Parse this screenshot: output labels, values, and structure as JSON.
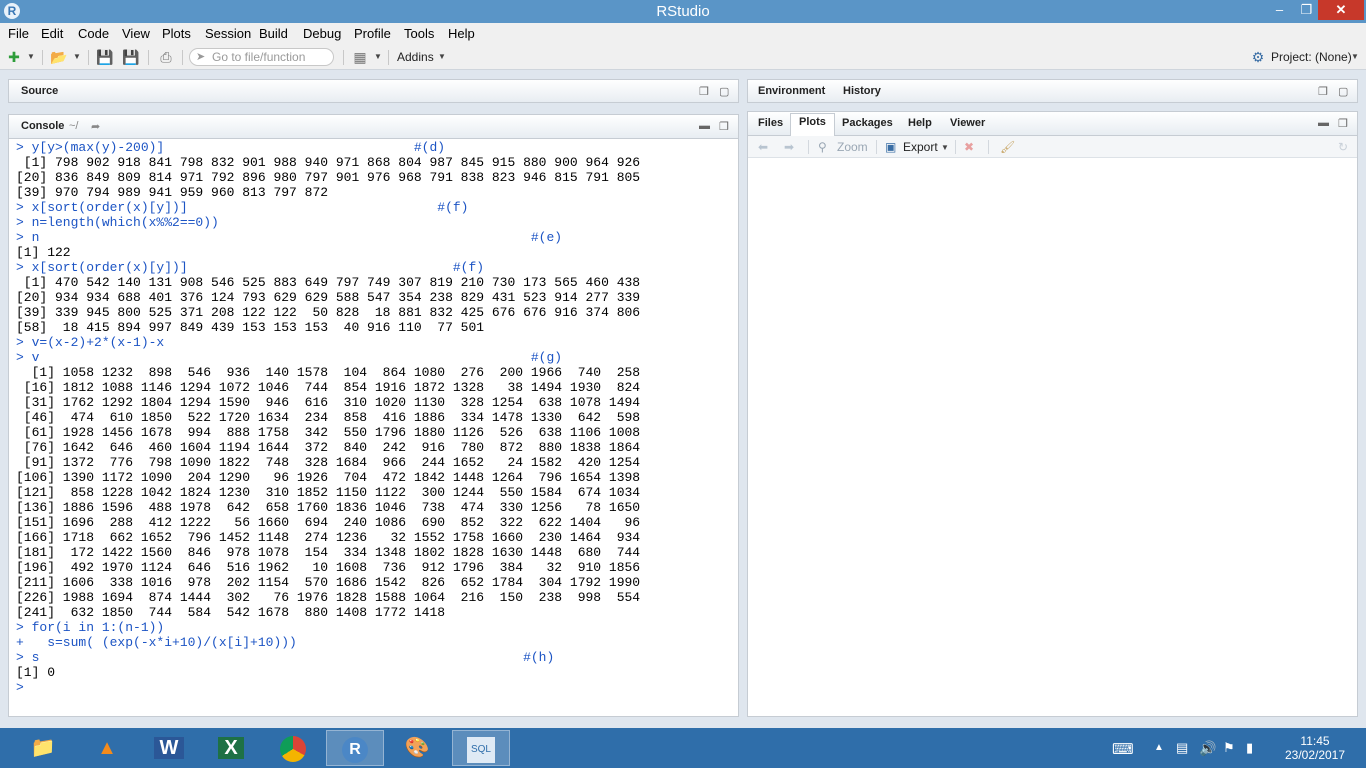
{
  "window": {
    "title": "RStudio"
  },
  "menu": [
    "File",
    "Edit",
    "Code",
    "View",
    "Plots",
    "Session",
    "Build",
    "Debug",
    "Profile",
    "Tools",
    "Help"
  ],
  "toolbar": {
    "goto_placeholder": "Go to file/function",
    "addins_label": "Addins",
    "project_label": "Project: (None)"
  },
  "source_pane": {
    "tab_label": "Source"
  },
  "console": {
    "tab_label": "Console",
    "path": "~/",
    "lines": [
      {
        "t": "cmd",
        "s": "> y[y>(max(y)-200)]                                #(d)"
      },
      {
        "t": "out",
        "s": " [1] 798 902 918 841 798 832 901 988 940 971 868 804 987 845 915 880 900 964 926"
      },
      {
        "t": "out",
        "s": "[20] 836 849 809 814 971 792 896 980 797 901 976 968 791 838 823 946 815 791 805"
      },
      {
        "t": "out",
        "s": "[39] 970 794 989 941 959 960 813 797 872"
      },
      {
        "t": "cmd",
        "s": "> x[sort(order(x)[y])]                                #(f)"
      },
      {
        "t": "cmd",
        "s": "> n=length(which(x%%2==0))"
      },
      {
        "t": "cmd",
        "s": "> n                                                               #(e)"
      },
      {
        "t": "out",
        "s": "[1] 122"
      },
      {
        "t": "cmd",
        "s": "> x[sort(order(x)[y])]                                  #(f)"
      },
      {
        "t": "out",
        "s": " [1] 470 542 140 131 908 546 525 883 649 797 749 307 819 210 730 173 565 460 438"
      },
      {
        "t": "out",
        "s": "[20] 934 934 688 401 376 124 793 629 629 588 547 354 238 829 431 523 914 277 339"
      },
      {
        "t": "out",
        "s": "[39] 339 945 800 525 371 208 122 122  50 828  18 881 832 425 676 676 916 374 806"
      },
      {
        "t": "out",
        "s": "[58]  18 415 894 997 849 439 153 153 153  40 916 110  77 501"
      },
      {
        "t": "cmd",
        "s": "> v=(x-2)+2*(x-1)-x"
      },
      {
        "t": "cmd",
        "s": "> v                                                               #(g)"
      },
      {
        "t": "out",
        "s": "  [1] 1058 1232  898  546  936  140 1578  104  864 1080  276  200 1966  740  258"
      },
      {
        "t": "out",
        "s": " [16] 1812 1088 1146 1294 1072 1046  744  854 1916 1872 1328   38 1494 1930  824"
      },
      {
        "t": "out",
        "s": " [31] 1762 1292 1804 1294 1590  946  616  310 1020 1130  328 1254  638 1078 1494"
      },
      {
        "t": "out",
        "s": " [46]  474  610 1850  522 1720 1634  234  858  416 1886  334 1478 1330  642  598"
      },
      {
        "t": "out",
        "s": " [61] 1928 1456 1678  994  888 1758  342  550 1796 1880 1126  526  638 1106 1008"
      },
      {
        "t": "out",
        "s": " [76] 1642  646  460 1604 1194 1644  372  840  242  916  780  872  880 1838 1864"
      },
      {
        "t": "out",
        "s": " [91] 1372  776  798 1090 1822  748  328 1684  966  244 1652   24 1582  420 1254"
      },
      {
        "t": "out",
        "s": "[106] 1390 1172 1090  204 1290   96 1926  704  472 1842 1448 1264  796 1654 1398"
      },
      {
        "t": "out",
        "s": "[121]  858 1228 1042 1824 1230  310 1852 1150 1122  300 1244  550 1584  674 1034"
      },
      {
        "t": "out",
        "s": "[136] 1886 1596  488 1978  642  658 1760 1836 1046  738  474  330 1256   78 1650"
      },
      {
        "t": "out",
        "s": "[151] 1696  288  412 1222   56 1660  694  240 1086  690  852  322  622 1404   96"
      },
      {
        "t": "out",
        "s": "[166] 1718  662 1652  796 1452 1148  274 1236   32 1552 1758 1660  230 1464  934"
      },
      {
        "t": "out",
        "s": "[181]  172 1422 1560  846  978 1078  154  334 1348 1802 1828 1630 1448  680  744"
      },
      {
        "t": "out",
        "s": "[196]  492 1970 1124  646  516 1962   10 1608  736  912 1796  384   32  910 1856"
      },
      {
        "t": "out",
        "s": "[211] 1606  338 1016  978  202 1154  570 1686 1542  826  652 1784  304 1792 1990"
      },
      {
        "t": "out",
        "s": "[226] 1988 1694  874 1444  302   76 1976 1828 1588 1064  216  150  238  998  554"
      },
      {
        "t": "out",
        "s": "[241]  632 1850  744  584  542 1678  880 1408 1772 1418"
      },
      {
        "t": "cmd",
        "s": "> for(i in 1:(n-1))"
      },
      {
        "t": "cmd",
        "s": "+   s=sum( (exp(-x*i+10)/(x[i]+10)))"
      },
      {
        "t": "cmd",
        "s": "> s                                                              #(h)"
      },
      {
        "t": "out",
        "s": "[1] 0"
      },
      {
        "t": "cmd",
        "s": "> "
      }
    ]
  },
  "env_pane": {
    "tabs": [
      "Environment",
      "History"
    ]
  },
  "files_pane": {
    "tabs": [
      "Files",
      "Plots",
      "Packages",
      "Help",
      "Viewer"
    ],
    "active_tab": "Plots",
    "zoom_label": "Zoom",
    "export_label": "Export"
  },
  "taskbar": {
    "apps": [
      "file-explorer",
      "vlc",
      "word",
      "excel",
      "chrome",
      "rstudio",
      "paint",
      "mysql-installer"
    ],
    "active_app": "rstudio",
    "time": "11:45",
    "date": "23/02/2017"
  },
  "colors": {
    "titlebar": "#5a95c7",
    "console_command": "#1c54c4",
    "taskbar": "#2f6eaa"
  }
}
